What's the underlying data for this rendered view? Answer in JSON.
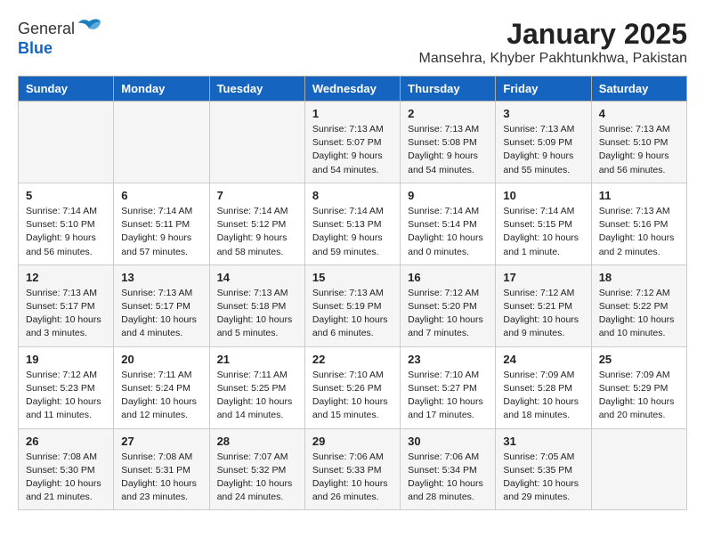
{
  "header": {
    "logo_general": "General",
    "logo_blue": "Blue",
    "title": "January 2025",
    "subtitle": "Mansehra, Khyber Pakhtunkhwa, Pakistan"
  },
  "weekdays": [
    "Sunday",
    "Monday",
    "Tuesday",
    "Wednesday",
    "Thursday",
    "Friday",
    "Saturday"
  ],
  "weeks": [
    [
      {
        "day": "",
        "info": ""
      },
      {
        "day": "",
        "info": ""
      },
      {
        "day": "",
        "info": ""
      },
      {
        "day": "1",
        "info": "Sunrise: 7:13 AM\nSunset: 5:07 PM\nDaylight: 9 hours\nand 54 minutes."
      },
      {
        "day": "2",
        "info": "Sunrise: 7:13 AM\nSunset: 5:08 PM\nDaylight: 9 hours\nand 54 minutes."
      },
      {
        "day": "3",
        "info": "Sunrise: 7:13 AM\nSunset: 5:09 PM\nDaylight: 9 hours\nand 55 minutes."
      },
      {
        "day": "4",
        "info": "Sunrise: 7:13 AM\nSunset: 5:10 PM\nDaylight: 9 hours\nand 56 minutes."
      }
    ],
    [
      {
        "day": "5",
        "info": "Sunrise: 7:14 AM\nSunset: 5:10 PM\nDaylight: 9 hours\nand 56 minutes."
      },
      {
        "day": "6",
        "info": "Sunrise: 7:14 AM\nSunset: 5:11 PM\nDaylight: 9 hours\nand 57 minutes."
      },
      {
        "day": "7",
        "info": "Sunrise: 7:14 AM\nSunset: 5:12 PM\nDaylight: 9 hours\nand 58 minutes."
      },
      {
        "day": "8",
        "info": "Sunrise: 7:14 AM\nSunset: 5:13 PM\nDaylight: 9 hours\nand 59 minutes."
      },
      {
        "day": "9",
        "info": "Sunrise: 7:14 AM\nSunset: 5:14 PM\nDaylight: 10 hours\nand 0 minutes."
      },
      {
        "day": "10",
        "info": "Sunrise: 7:14 AM\nSunset: 5:15 PM\nDaylight: 10 hours\nand 1 minute."
      },
      {
        "day": "11",
        "info": "Sunrise: 7:13 AM\nSunset: 5:16 PM\nDaylight: 10 hours\nand 2 minutes."
      }
    ],
    [
      {
        "day": "12",
        "info": "Sunrise: 7:13 AM\nSunset: 5:17 PM\nDaylight: 10 hours\nand 3 minutes."
      },
      {
        "day": "13",
        "info": "Sunrise: 7:13 AM\nSunset: 5:17 PM\nDaylight: 10 hours\nand 4 minutes."
      },
      {
        "day": "14",
        "info": "Sunrise: 7:13 AM\nSunset: 5:18 PM\nDaylight: 10 hours\nand 5 minutes."
      },
      {
        "day": "15",
        "info": "Sunrise: 7:13 AM\nSunset: 5:19 PM\nDaylight: 10 hours\nand 6 minutes."
      },
      {
        "day": "16",
        "info": "Sunrise: 7:12 AM\nSunset: 5:20 PM\nDaylight: 10 hours\nand 7 minutes."
      },
      {
        "day": "17",
        "info": "Sunrise: 7:12 AM\nSunset: 5:21 PM\nDaylight: 10 hours\nand 9 minutes."
      },
      {
        "day": "18",
        "info": "Sunrise: 7:12 AM\nSunset: 5:22 PM\nDaylight: 10 hours\nand 10 minutes."
      }
    ],
    [
      {
        "day": "19",
        "info": "Sunrise: 7:12 AM\nSunset: 5:23 PM\nDaylight: 10 hours\nand 11 minutes."
      },
      {
        "day": "20",
        "info": "Sunrise: 7:11 AM\nSunset: 5:24 PM\nDaylight: 10 hours\nand 12 minutes."
      },
      {
        "day": "21",
        "info": "Sunrise: 7:11 AM\nSunset: 5:25 PM\nDaylight: 10 hours\nand 14 minutes."
      },
      {
        "day": "22",
        "info": "Sunrise: 7:10 AM\nSunset: 5:26 PM\nDaylight: 10 hours\nand 15 minutes."
      },
      {
        "day": "23",
        "info": "Sunrise: 7:10 AM\nSunset: 5:27 PM\nDaylight: 10 hours\nand 17 minutes."
      },
      {
        "day": "24",
        "info": "Sunrise: 7:09 AM\nSunset: 5:28 PM\nDaylight: 10 hours\nand 18 minutes."
      },
      {
        "day": "25",
        "info": "Sunrise: 7:09 AM\nSunset: 5:29 PM\nDaylight: 10 hours\nand 20 minutes."
      }
    ],
    [
      {
        "day": "26",
        "info": "Sunrise: 7:08 AM\nSunset: 5:30 PM\nDaylight: 10 hours\nand 21 minutes."
      },
      {
        "day": "27",
        "info": "Sunrise: 7:08 AM\nSunset: 5:31 PM\nDaylight: 10 hours\nand 23 minutes."
      },
      {
        "day": "28",
        "info": "Sunrise: 7:07 AM\nSunset: 5:32 PM\nDaylight: 10 hours\nand 24 minutes."
      },
      {
        "day": "29",
        "info": "Sunrise: 7:06 AM\nSunset: 5:33 PM\nDaylight: 10 hours\nand 26 minutes."
      },
      {
        "day": "30",
        "info": "Sunrise: 7:06 AM\nSunset: 5:34 PM\nDaylight: 10 hours\nand 28 minutes."
      },
      {
        "day": "31",
        "info": "Sunrise: 7:05 AM\nSunset: 5:35 PM\nDaylight: 10 hours\nand 29 minutes."
      },
      {
        "day": "",
        "info": ""
      }
    ]
  ]
}
